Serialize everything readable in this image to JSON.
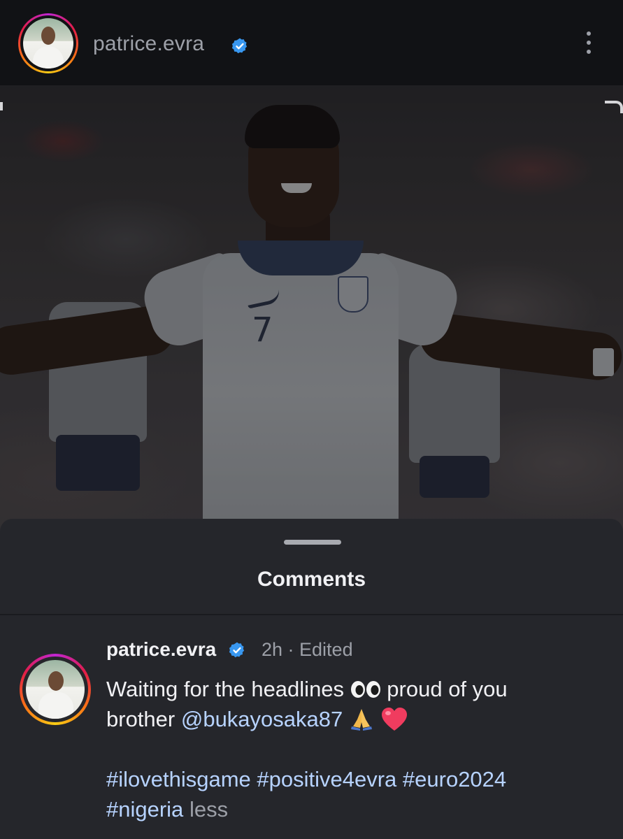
{
  "header": {
    "username": "patrice.evra",
    "verified": true,
    "avatar_icon": "profile-photo",
    "menu_icon": "more-vertical-icon"
  },
  "post": {
    "image_icon": "post-photo",
    "jersey_number": "7"
  },
  "comments_sheet": {
    "title": "Comments",
    "comment": {
      "username": "patrice.evra",
      "meta": "2h · Edited",
      "text_line1": "Waiting for the headlines",
      "emoji_1": "eyes-emoji",
      "text_after_emoji": "proud of you",
      "text_line2": "brother",
      "mention": "@bukayosaka87",
      "emoji_2": "folded-hands-emoji",
      "emoji_3": "red-heart-emoji",
      "hashtags_line1": "#ilovethisgame #positive4evra #euro2024",
      "hashtags_line2": "#nigeria",
      "less_label": "less"
    }
  },
  "colors": {
    "background": "#101114",
    "sheet": "#25262b",
    "link": "#b7d3ff",
    "verified": "#3897f0",
    "muted": "#9da0a8"
  }
}
